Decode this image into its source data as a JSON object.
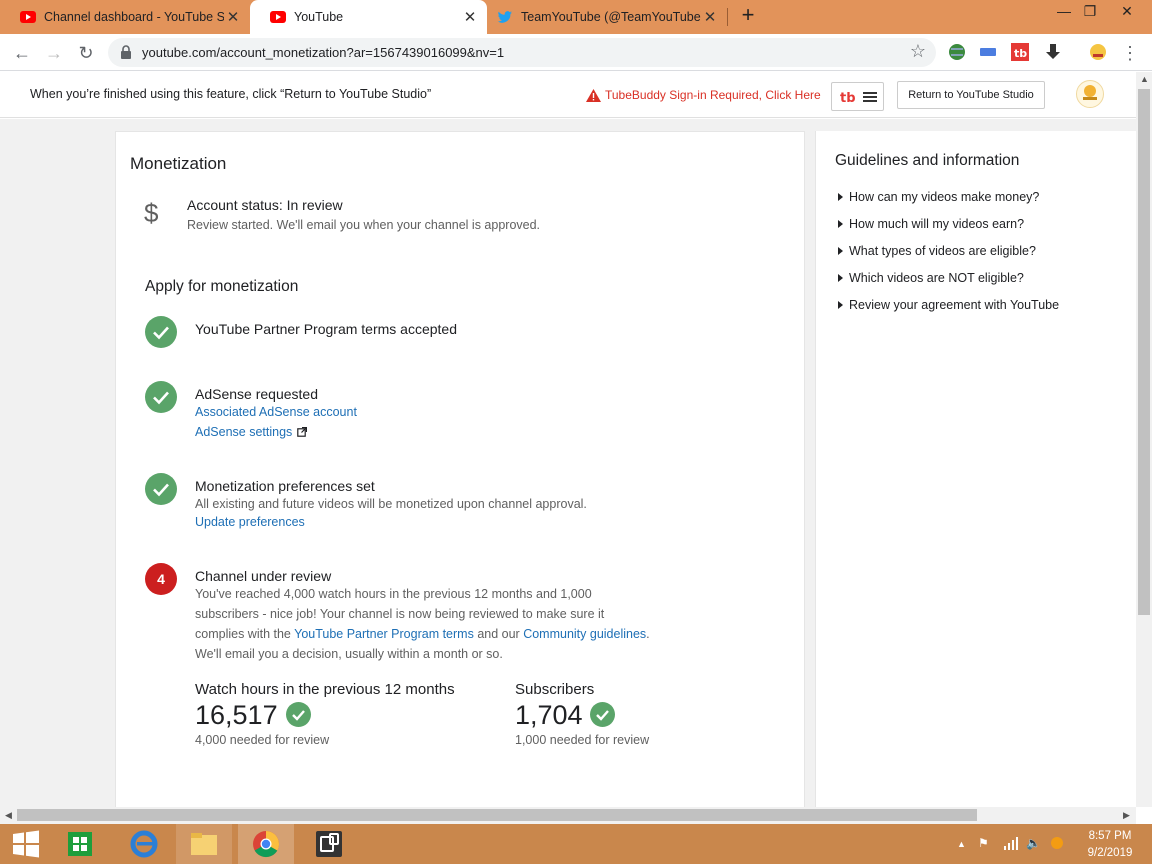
{
  "browser": {
    "tabs": [
      {
        "title": "Channel dashboard - YouTube St",
        "icon": "youtube-icon"
      },
      {
        "title": "YouTube",
        "icon": "youtube-icon"
      },
      {
        "title": "TeamYouTube (@TeamYouTube)",
        "icon": "twitter-icon"
      }
    ],
    "url": "youtube.com/account_monetization?ar=1567439016099&nv=1"
  },
  "studio_bar": {
    "message": "When you’re finished using this feature, click “Return to YouTube Studio”",
    "tubebuddy_warning": "TubeBuddy Sign-in Required, Click Here",
    "return_button": "Return to YouTube Studio"
  },
  "main": {
    "title": "Monetization",
    "account_status": "Account status: In review",
    "account_status_sub": "Review started. We'll email you when your channel is approved.",
    "apply_heading": "Apply for monetization",
    "steps": [
      {
        "title": "YouTube Partner Program terms accepted"
      },
      {
        "title": "AdSense requested",
        "link1": "Associated AdSense account",
        "link2": "AdSense settings"
      },
      {
        "title": "Monetization preferences set",
        "text": "All existing and future videos will be monetized upon channel approval.",
        "link1": "Update preferences"
      },
      {
        "number": "4",
        "title": "Channel under review",
        "text_a": "You've reached 4,000 watch hours in the previous 12 months and 1,000",
        "text_b": "subscribers - nice job! Your channel is now being reviewed to make sure it",
        "text_c1": "complies with the ",
        "link_terms": "YouTube Partner Program terms",
        "text_c2": " and our ",
        "link_guidelines": "Community guidelines",
        "text_c3": ".",
        "text_d": "We'll email you a decision, usually within a month or so."
      }
    ],
    "metrics": [
      {
        "label": "Watch hours in the previous 12 months",
        "value": "16,517",
        "sub": "4,000 needed for review"
      },
      {
        "label": "Subscribers",
        "value": "1,704",
        "sub": "1,000 needed for review"
      }
    ]
  },
  "sidebar": {
    "title": "Guidelines and information",
    "items": [
      "How can my videos make money?",
      "How much will my videos earn?",
      "What types of videos are eligible?",
      "Which videos are NOT eligible?",
      "Review your agreement with YouTube"
    ]
  },
  "taskbar": {
    "time": "8:57 PM",
    "date": "9/2/2019"
  },
  "colors": {
    "check_green": "#5aa469",
    "step_red": "#cc1f1f",
    "link_blue": "#1e6fb5",
    "tab_strip": "#e2935a"
  }
}
